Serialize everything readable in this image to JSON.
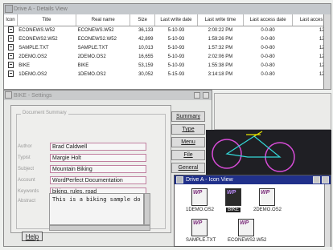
{
  "details_window": {
    "title": "Drive A - Details View",
    "columns": [
      "Icon",
      "Title",
      "Real name",
      "Size",
      "Last write date",
      "Last write time",
      "Last access date",
      "Last acces"
    ],
    "rows": [
      {
        "title": "ECONEWS.W52",
        "real": "ECONEWS.W52",
        "size": "36,133",
        "wdate": "5-10-93",
        "wtime": "2:00:22 PM",
        "adate": "0-0-80",
        "a2": "12:0"
      },
      {
        "title": "ECONEWS2.W52",
        "real": "ECONEWS2.W52",
        "size": "42,899",
        "wdate": "5-10-93",
        "wtime": "1:59:26 PM",
        "adate": "0-0-80",
        "a2": "12:0"
      },
      {
        "title": "SAMPLE.TXT",
        "real": "SAMPLE.TXT",
        "size": "10,013",
        "wdate": "5-10-93",
        "wtime": "1:57:32 PM",
        "adate": "0-0-80",
        "a2": "12:0"
      },
      {
        "title": "2DEMO.OS2",
        "real": "2DEMO.OS2",
        "size": "16,655",
        "wdate": "5-10-93",
        "wtime": "2:02:06 PM",
        "adate": "0-0-80",
        "a2": "12:0"
      },
      {
        "title": "BIKE",
        "real": "BIKE",
        "size": "53,159",
        "wdate": "5-10-93",
        "wtime": "1:55:38 PM",
        "adate": "0-0-80",
        "a2": "12:0"
      },
      {
        "title": "1DEMO.OS2",
        "real": "1DEMO.OS2",
        "size": "30,052",
        "wdate": "5-15-93",
        "wtime": "3:14:18 PM",
        "adate": "0-0-80",
        "a2": "12:0"
      }
    ]
  },
  "settings_window": {
    "title": "BIKE - Settings",
    "group_title": "Document Summary",
    "fields": [
      {
        "label": "Author",
        "value": "Brad Caldwell"
      },
      {
        "label": "Typist",
        "value": "Margie Holt"
      },
      {
        "label": "Subject",
        "value": "Mountain Biking"
      },
      {
        "label": "Account",
        "value": "WordPerfect Documentation"
      },
      {
        "label": "Keywords",
        "value": "biking, rules, road"
      }
    ],
    "abstract_label": "Abstract",
    "abstract_value": "This is a biking sample do",
    "tabs": [
      "Summary",
      "Type",
      "Menu",
      "File",
      "General"
    ],
    "help_label": "Help"
  },
  "icon_view": {
    "title": "Drive A - Icon View",
    "icons": [
      {
        "name": "1DEMO.OS2",
        "selected": false
      },
      {
        "name": "BIKE",
        "selected": true
      },
      {
        "name": "2DEMO.OS2",
        "selected": false
      },
      {
        "name": "SAMPLE.TXT",
        "selected": false
      },
      {
        "name": "ECONEWS2.W52",
        "selected": false
      }
    ],
    "glyph_text": "WP"
  }
}
